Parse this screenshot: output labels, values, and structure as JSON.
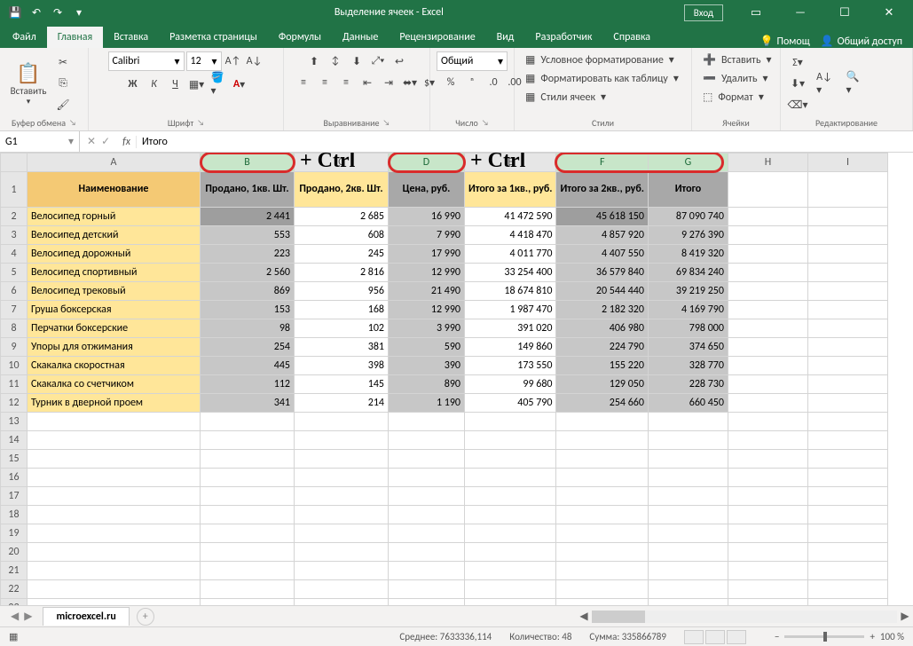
{
  "title": "Выделение ячеек  -  Excel",
  "signin": "Вход",
  "tabs": [
    "Файл",
    "Главная",
    "Вставка",
    "Разметка страницы",
    "Формулы",
    "Данные",
    "Рецензирование",
    "Вид",
    "Разработчик",
    "Справка"
  ],
  "activeTab": 1,
  "tabsRight": {
    "tellme": "Помощ",
    "share": "Общий доступ"
  },
  "ribbon": {
    "clipboard": {
      "paste": "Вставить",
      "label": "Буфер обмена"
    },
    "font": {
      "name": "Calibri",
      "size": "12",
      "label": "Шрифт",
      "bold": "Ж",
      "italic": "К",
      "underline": "Ч"
    },
    "align": {
      "label": "Выравнивание"
    },
    "number": {
      "format": "Общий",
      "label": "Число"
    },
    "styles": {
      "cond": "Условное форматирование",
      "table": "Форматировать как таблицу",
      "cell": "Стили ячеек",
      "label": "Стили"
    },
    "cells": {
      "insert": "Вставить",
      "delete": "Удалить",
      "format": "Формат",
      "label": "Ячейки"
    },
    "editing": {
      "label": "Редактирование"
    }
  },
  "nameBox": "G1",
  "formula": "Итого",
  "annot": {
    "ctrl1": "+ Ctrl",
    "ctrl2": "+ Ctrl"
  },
  "cols": [
    "A",
    "B",
    "C",
    "D",
    "E",
    "F",
    "G",
    "H",
    "I"
  ],
  "selCols": {
    "B": true,
    "D": true,
    "F": true,
    "G": true
  },
  "headers": {
    "A": "Наименование",
    "B": "Продано, 1кв. Шт.",
    "C": "Продано, 2кв. Шт.",
    "D": "Цена, руб.",
    "E": "Итого за 1кв., руб.",
    "F": "Итого за 2кв., руб.",
    "G": "Итого"
  },
  "rows": [
    {
      "n": "Велосипед горный",
      "b": "2 441",
      "c": "2 685",
      "d": "16 990",
      "e": "41 472 590",
      "f": "45 618 150",
      "g": "87 090 740"
    },
    {
      "n": "Велосипед детский",
      "b": "553",
      "c": "608",
      "d": "7 990",
      "e": "4 418 470",
      "f": "4 857 920",
      "g": "9 276 390"
    },
    {
      "n": "Велосипед дорожный",
      "b": "223",
      "c": "245",
      "d": "17 990",
      "e": "4 011 770",
      "f": "4 407 550",
      "g": "8 419 320"
    },
    {
      "n": "Велосипед спортивный",
      "b": "2 560",
      "c": "2 816",
      "d": "12 990",
      "e": "33 254 400",
      "f": "36 579 840",
      "g": "69 834 240"
    },
    {
      "n": "Велосипед трековый",
      "b": "869",
      "c": "956",
      "d": "21 490",
      "e": "18 674 810",
      "f": "20 544 440",
      "g": "39 219 250"
    },
    {
      "n": "Груша боксерская",
      "b": "153",
      "c": "168",
      "d": "12 990",
      "e": "1 987 470",
      "f": "2 182 320",
      "g": "4 169 790"
    },
    {
      "n": "Перчатки боксерские",
      "b": "98",
      "c": "102",
      "d": "3 990",
      "e": "391 020",
      "f": "406 980",
      "g": "798 000"
    },
    {
      "n": "Упоры для отжимания",
      "b": "254",
      "c": "381",
      "d": "590",
      "e": "149 860",
      "f": "224 790",
      "g": "374 650"
    },
    {
      "n": "Скакалка скоростная",
      "b": "445",
      "c": "398",
      "d": "390",
      "e": "173 550",
      "f": "155 220",
      "g": "328 770"
    },
    {
      "n": "Скакалка со счетчиком",
      "b": "112",
      "c": "145",
      "d": "890",
      "e": "99 680",
      "f": "129 050",
      "g": "228 730"
    },
    {
      "n": "Турник в дверной проем",
      "b": "341",
      "c": "214",
      "d": "1 190",
      "e": "405 790",
      "f": "254 660",
      "g": "660 450"
    }
  ],
  "emptyRows": 11,
  "sheetTab": "microexcel.ru",
  "status": {
    "avg": "Среднее: 7633336,114",
    "count": "Количество: 48",
    "sum": "Сумма: 335866789",
    "zoom": "100 %"
  }
}
